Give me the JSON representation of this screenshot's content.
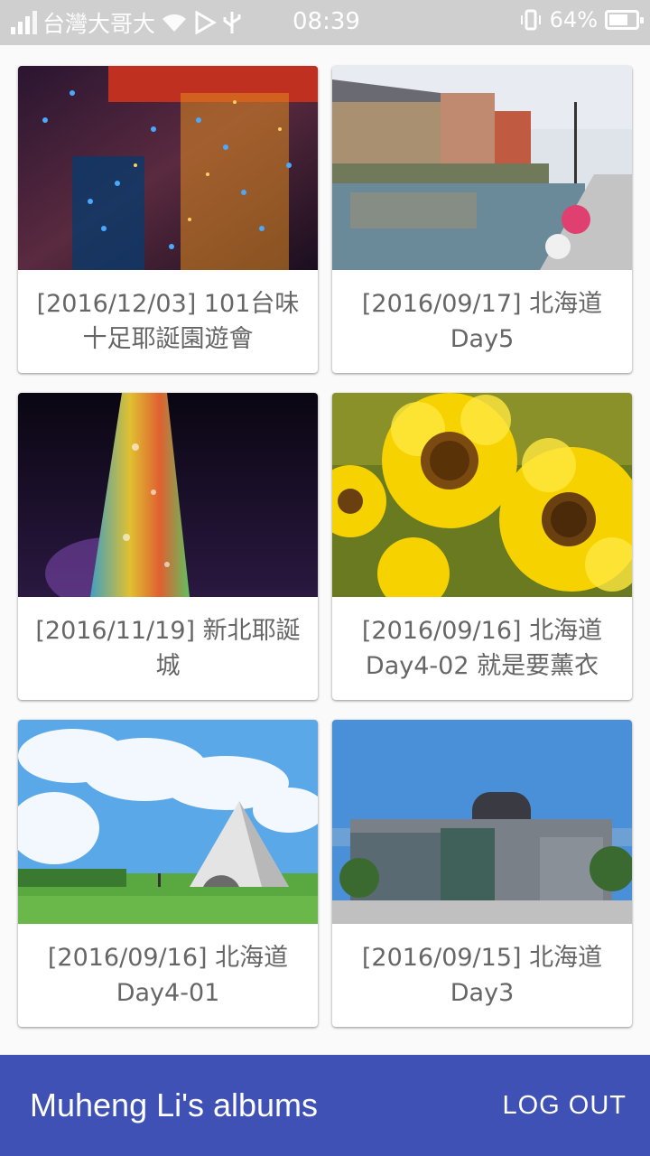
{
  "status_bar": {
    "carrier": "台灣大哥大",
    "time": "08:39",
    "battery": "64%",
    "battery_level": 0.64,
    "icons": [
      "signal-icon",
      "wifi-icon",
      "play-store-icon",
      "usb-icon",
      "vibrate-icon",
      "battery-icon"
    ]
  },
  "albums": [
    {
      "title": "[2016/12/03] 101台味十足耶誕園遊會",
      "thumb": "christmas-lights-photo"
    },
    {
      "title": "[2016/09/17] 北海道 Day5",
      "thumb": "otaru-canal-photo"
    },
    {
      "title": "[2016/11/19] 新北耶誕城",
      "thumb": "christmas-tree-tower-photo"
    },
    {
      "title": "[2016/09/16] 北海道 Day4-02 就是要薰衣",
      "thumb": "sunflowers-photo"
    },
    {
      "title": "[2016/09/16] 北海道 Day4-01",
      "thumb": "pyramid-monument-photo"
    },
    {
      "title": "[2016/09/15] 北海道 Day3",
      "thumb": "station-building-photo"
    }
  ],
  "bottom_bar": {
    "title": "Muheng Li's albums",
    "logout_label": "LOG OUT",
    "color": "#3f51b5"
  }
}
